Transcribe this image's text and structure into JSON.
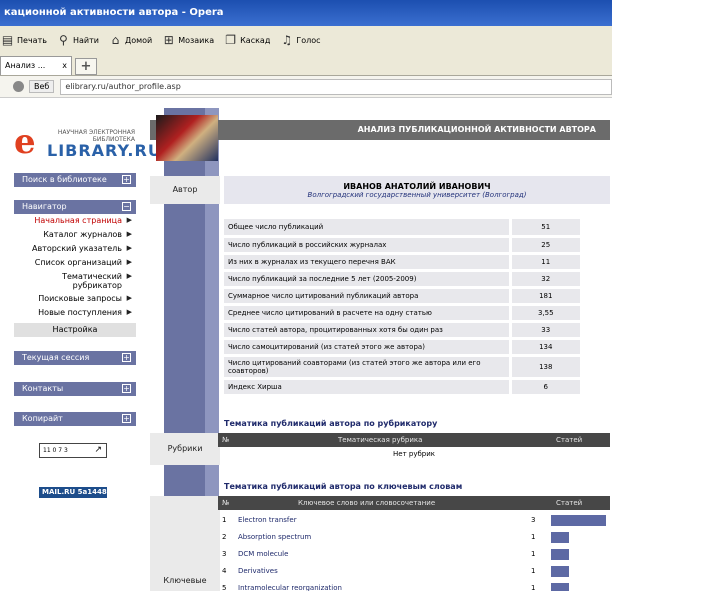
{
  "window": {
    "title": "кационной активности автора - Opera"
  },
  "toolbar": {
    "items": [
      {
        "icon": "printer-icon",
        "label": "Печать"
      },
      {
        "icon": "search-icon",
        "label": "Найти"
      },
      {
        "icon": "home-icon",
        "label": "Домой"
      },
      {
        "icon": "tile-icon",
        "label": "Мозаика"
      },
      {
        "icon": "cascade-icon",
        "label": "Каскад"
      },
      {
        "icon": "microphone-icon",
        "label": "Голос"
      }
    ]
  },
  "tabs": {
    "active": "Анализ ...",
    "close": "x",
    "new": "+"
  },
  "address": {
    "web_label": "Веб",
    "url": "elibrary.ru/author_profile.asp"
  },
  "logo": {
    "small": "НАУЧНАЯ ЭЛЕКТРОННАЯ БИБЛИОТЕКА",
    "big": "LIBRARY.RU",
    "letter": "e"
  },
  "sidebar": {
    "search": "Поиск в библиотеке",
    "navigator": "Навигатор",
    "nav_items": [
      "Начальная страница",
      "Каталог журналов",
      "Авторский указатель",
      "Список организаций",
      "Тематический рубрикатор",
      "Поисковые запросы",
      "Новые поступления"
    ],
    "settings": "Настройка",
    "session": "Текущая сессия",
    "contacts": "Контакты",
    "copyright": "Копирайт",
    "counter": "11 0 7 3",
    "mail": "MAIL.RU 5а1448"
  },
  "main": {
    "header": "АНАЛИЗ ПУБЛИКАЦИОННОЙ АКТИВНОСТИ АВТОРА",
    "author_label": "Автор",
    "author_name": "ИВАНОВ АНАТОЛИЙ ИВАНОВИЧ",
    "author_affiliation": "Волгоградский государственный университет (Волгоград)",
    "stats": [
      {
        "label": "Общее число публикаций",
        "value": "51"
      },
      {
        "label": "Число публикаций в российских журналах",
        "value": "25"
      },
      {
        "label": "Из них в журналах из текущего перечня ВАК",
        "value": "11"
      },
      {
        "label": "Число публикаций за последние 5 лет (2005-2009)",
        "value": "32"
      },
      {
        "label": "Суммарное число цитирований публикаций автора",
        "value": "181"
      },
      {
        "label": "Среднее число цитирований в расчете на одну статью",
        "value": "3,55"
      },
      {
        "label": "Число статей автора, процитированных хотя бы один раз",
        "value": "33"
      },
      {
        "label": "Число самоцитирований (из статей этого же автора)",
        "value": "134"
      },
      {
        "label": "Число цитирований соавторами (из статей этого же автора или его соавторов)",
        "value": "138"
      },
      {
        "label": "Индекс Хирша",
        "value": "6"
      }
    ],
    "rubric_title": "Тематика публикаций автора по рубрикатору",
    "rubric_label": "Рубрики",
    "rubric_cols": [
      "№",
      "Тематическая рубрика",
      "Статей"
    ],
    "rubric_empty": "Нет рубрик",
    "keyword_title": "Тематика публикаций автора по ключевым словам",
    "keyword_label": "Ключевые",
    "keyword_cols": [
      "№",
      "Ключевое слово или словосочетание",
      "Статей"
    ],
    "keywords": [
      {
        "n": "1",
        "word": "Electron transfer",
        "count": 3
      },
      {
        "n": "2",
        "word": "Absorption spectrum",
        "count": 1
      },
      {
        "n": "3",
        "word": "DCM molecule",
        "count": 1
      },
      {
        "n": "4",
        "word": "Derivatives",
        "count": 1
      },
      {
        "n": "5",
        "word": "Intramolecular reorganization",
        "count": 1
      }
    ]
  },
  "colors": {
    "sidebar_header": "#6a73a2",
    "link_active": "#c00000",
    "bar": "#5d69a4"
  }
}
